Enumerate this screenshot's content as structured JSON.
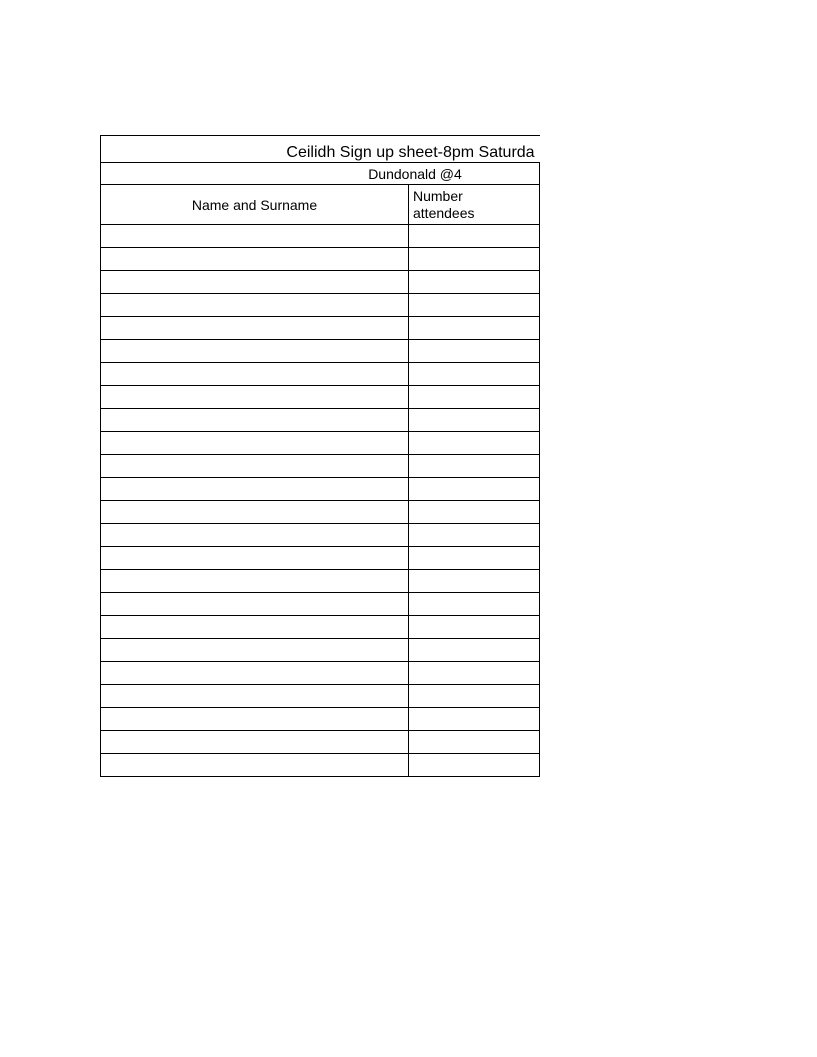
{
  "title": "Ceilidh Sign up sheet-8pm Saturda",
  "subtitle": "Dundonald @4",
  "headers": {
    "name": "Name and Surname",
    "number_line1": "Number",
    "number_line2": "attendees"
  },
  "row_count": 24
}
